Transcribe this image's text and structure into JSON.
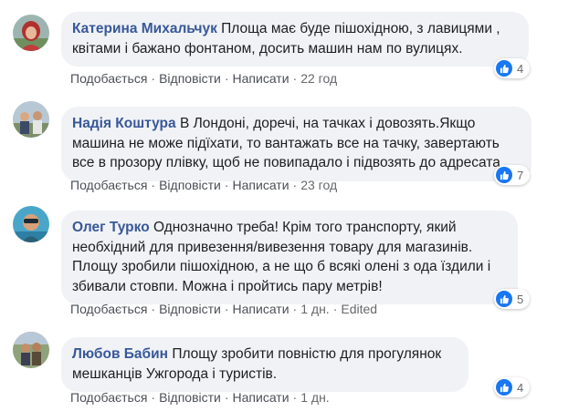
{
  "comments": [
    {
      "author": "Катерина Михальчук",
      "text": "Площа має буде пішохідною, з лавицями , квітами і бажано фонтаном, досить машин нам по вулицях.",
      "like": "Подобається",
      "reply": "Відповісти",
      "message": "Написати",
      "time": "22 год",
      "reactions": "4"
    },
    {
      "author": "Надія Коштура",
      "text": "В Лондоні, доречі, на тачках і довозять.Якщо машина не може підїхати, то вантажать все на тачку, завертають все в прозору плівку, щоб не повипадало і підвозять до адресата",
      "like": "Подобається",
      "reply": "Відповісти",
      "message": "Написати",
      "time": "23 год",
      "reactions": "7"
    },
    {
      "author": "Олег Турко",
      "text": "Однозначно треба! Крім того транспорту, який необхідний для привезення/вивезення товару для магазинів. Площу зробили пішохідною, а не що б всякі олені з ода їздили і збивали стовпи. Можна і пройтись пару метрів!",
      "like": "Подобається",
      "reply": "Відповісти",
      "message": "Написати",
      "time": "1 дн.",
      "edited": "Edited",
      "reactions": "5"
    },
    {
      "author": "Любов Бабин",
      "text": "Площу зробити повністю для прогулянок мешканців Ужгорода і туристів.",
      "like": "Подобається",
      "reply": "Відповісти",
      "message": "Написати",
      "time": "1 дн.",
      "reactions": "4"
    }
  ],
  "separator": "·",
  "icons": {
    "reaction": "like-thumb-icon"
  },
  "colors": {
    "author": "#385898",
    "bubble": "#f0f2f5",
    "like": "#1877f2"
  }
}
